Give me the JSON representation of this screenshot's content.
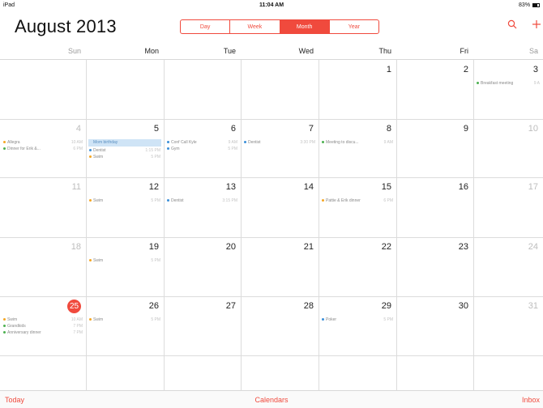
{
  "status_bar": {
    "device": "iPad",
    "time": "11:04 AM",
    "battery": "83%"
  },
  "header": {
    "month": "August",
    "year": "2013",
    "view_modes": [
      "Day",
      "Week",
      "Month",
      "Year"
    ],
    "active_view": "Month",
    "search_icon": "search-icon",
    "add_icon": "plus-icon"
  },
  "weekdays": [
    "Sun",
    "Mon",
    "Tue",
    "Wed",
    "Thu",
    "Fri",
    "Sa"
  ],
  "weeks": [
    {
      "days": [
        {
          "num": "",
          "events": []
        },
        {
          "num": "",
          "events": []
        },
        {
          "num": "",
          "events": []
        },
        {
          "num": "",
          "events": []
        },
        {
          "num": "1",
          "events": []
        },
        {
          "num": "2",
          "events": []
        },
        {
          "num": "3",
          "events": [
            {
              "title": "Breakfast meeting",
              "time": "9 A",
              "color": "#4cb050"
            }
          ]
        }
      ]
    },
    {
      "days": [
        {
          "num": "4",
          "dim": true,
          "events": [
            {
              "title": "Allegra",
              "time": "10 AM",
              "color": "#f5a623"
            },
            {
              "title": "Dinner for Erik &...",
              "time": "6 PM",
              "color": "#4cb050"
            }
          ]
        },
        {
          "num": "5",
          "allday": "Mom birthday",
          "events": [
            {
              "title": "Dentist",
              "time": "1:15 PM",
              "color": "#3b8fd8"
            },
            {
              "title": "Swim",
              "time": "5 PM",
              "color": "#f5a623"
            }
          ]
        },
        {
          "num": "6",
          "events": [
            {
              "title": "Conf Call Kyle",
              "time": "9 AM",
              "color": "#3b8fd8"
            },
            {
              "title": "Gym",
              "time": "5 PM",
              "color": "#3b8fd8"
            }
          ]
        },
        {
          "num": "7",
          "events": [
            {
              "title": "Dentist",
              "time": "3:30 PM",
              "color": "#3b8fd8"
            }
          ]
        },
        {
          "num": "8",
          "events": [
            {
              "title": "Meeting to discu...",
              "time": "9 AM",
              "color": "#4cb050"
            }
          ]
        },
        {
          "num": "9",
          "events": []
        },
        {
          "num": "10",
          "dim": true,
          "events": []
        }
      ]
    },
    {
      "days": [
        {
          "num": "11",
          "dim": true,
          "events": []
        },
        {
          "num": "12",
          "events": [
            {
              "title": "Swim",
              "time": "5 PM",
              "color": "#f5a623"
            }
          ]
        },
        {
          "num": "13",
          "events": [
            {
              "title": "Dentist",
              "time": "3:15 PM",
              "color": "#3b8fd8"
            }
          ]
        },
        {
          "num": "14",
          "events": []
        },
        {
          "num": "15",
          "events": [
            {
              "title": "Pattie & Erik dinner",
              "time": "6 PM",
              "color": "#f5a623"
            }
          ]
        },
        {
          "num": "16",
          "events": []
        },
        {
          "num": "17",
          "dim": true,
          "events": []
        }
      ]
    },
    {
      "days": [
        {
          "num": "18",
          "dim": true,
          "events": []
        },
        {
          "num": "19",
          "events": [
            {
              "title": "Swim",
              "time": "5 PM",
              "color": "#f5a623"
            }
          ]
        },
        {
          "num": "20",
          "events": []
        },
        {
          "num": "21",
          "events": []
        },
        {
          "num": "22",
          "events": []
        },
        {
          "num": "23",
          "events": []
        },
        {
          "num": "24",
          "dim": true,
          "events": []
        }
      ]
    },
    {
      "days": [
        {
          "num": "25",
          "today": true,
          "events": [
            {
              "title": "Swim",
              "time": "10 AM",
              "color": "#f5a623"
            },
            {
              "title": "Grandkids",
              "time": "7 PM",
              "color": "#4cb050"
            },
            {
              "title": "Anniversary dinner",
              "time": "7 PM",
              "color": "#4cb050"
            }
          ]
        },
        {
          "num": "26",
          "events": [
            {
              "title": "Swim",
              "time": "5 PM",
              "color": "#f5a623"
            }
          ]
        },
        {
          "num": "27",
          "events": []
        },
        {
          "num": "28",
          "events": []
        },
        {
          "num": "29",
          "events": [
            {
              "title": "Poker",
              "time": "5 PM",
              "color": "#3b8fd8"
            }
          ]
        },
        {
          "num": "30",
          "events": []
        },
        {
          "num": "31",
          "dim": true,
          "events": []
        }
      ]
    },
    {
      "days": [
        {
          "num": "",
          "events": []
        },
        {
          "num": "",
          "events": []
        },
        {
          "num": "",
          "events": []
        },
        {
          "num": "",
          "events": []
        },
        {
          "num": "",
          "events": []
        },
        {
          "num": "",
          "events": []
        },
        {
          "num": "",
          "events": []
        }
      ]
    }
  ],
  "bottom_bar": {
    "today": "Today",
    "calendars": "Calendars",
    "inbox": "Inbox"
  },
  "colors": {
    "accent": "#f04a3d",
    "allday_bg": "#cfe4f6"
  }
}
